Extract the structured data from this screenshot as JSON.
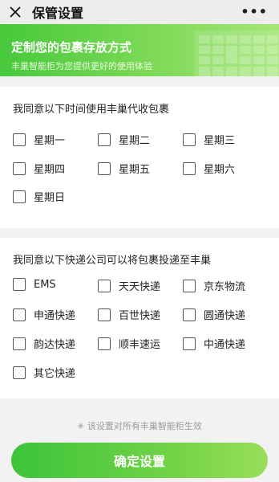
{
  "nav": {
    "title": "保管设置",
    "more": "•••",
    "close_icon": "close-icon"
  },
  "banner": {
    "title": "定制您的包裹存放方式",
    "subtitle": "丰巢智能柜为您提供更好的使用体验"
  },
  "days_section": {
    "title": "我同意以下时间使用丰巢代收包裹",
    "options": [
      "星期一",
      "星期二",
      "星期三",
      "星期四",
      "星期五",
      "星期六",
      "星期日"
    ],
    "checked": [
      false,
      false,
      false,
      false,
      false,
      false,
      false
    ]
  },
  "couriers_section": {
    "title": "我同意以下快递公司可以将包裹投递至丰巢",
    "options": [
      "EMS",
      "天天快递",
      "京东物流",
      "申通快递",
      "百世快递",
      "圆通快递",
      "韵达快递",
      "顺丰速运",
      "中通快递",
      "其它快递"
    ],
    "checked": [
      false,
      false,
      false,
      false,
      false,
      false,
      false,
      false,
      false,
      false
    ]
  },
  "footer": {
    "note": "✳ 该设置对所有丰巢智能柜生效",
    "confirm_label": "确定设置"
  },
  "colors": {
    "accent": "#4cc93d",
    "accent_light": "#9fe26a"
  }
}
